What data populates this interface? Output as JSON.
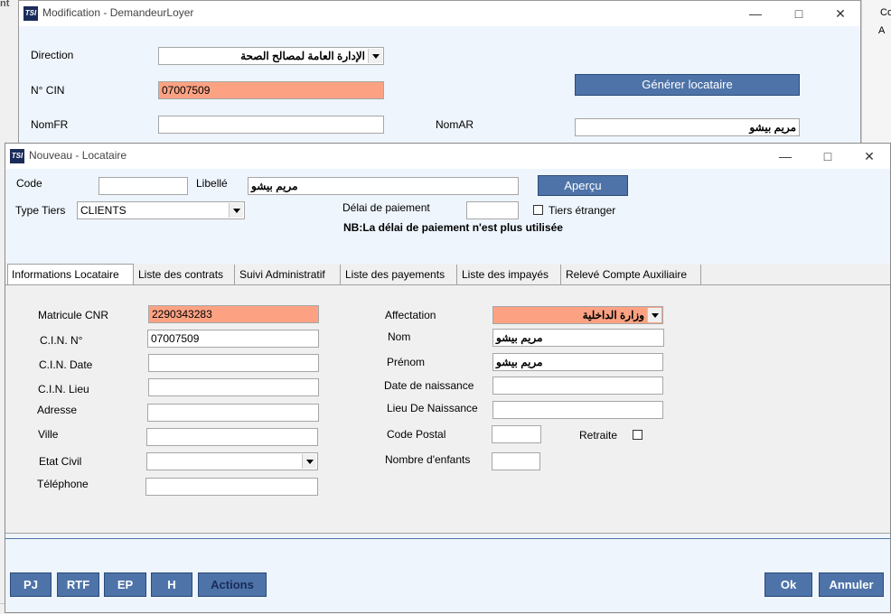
{
  "background_window": {
    "title": "Modification - DemandeurLoyer",
    "direction_label": "Direction",
    "direction_value": "الإدارة العامة لمصالح الصحة",
    "cin_label": "N° CIN",
    "cin_value": "07007509",
    "generate_button": "Générer locataire",
    "nomfr_label": "NomFR",
    "nomfr_value": "",
    "nomar_label": "NomAR",
    "nomar_value": "مريم بيشو"
  },
  "back_edge": {
    "top_left": "nt",
    "top_right": "Co",
    "second_right": "A"
  },
  "dialog": {
    "title": "Nouveau - Locataire",
    "code_label": "Code",
    "code_value": "",
    "libelle_label": "Libellé",
    "libelle_value": "مريم بيشو",
    "apercu_button": "Aperçu",
    "type_tiers_label": "Type Tiers",
    "type_tiers_value": "CLIENTS",
    "delai_label": "Délai de paiement",
    "delai_value": "",
    "tiers_etranger_label": "Tiers étranger",
    "note": "NB:La délai de paiement n'est plus utilisée"
  },
  "tabs": [
    "Informations Locataire",
    "Liste des contrats",
    "Suivi Administratif",
    "Liste des payements",
    "Liste des impayés",
    "Relevé Compte Auxiliaire"
  ],
  "form": {
    "matricule_label": "Matricule CNR",
    "matricule_value": "2290343283",
    "cin_label": "C.I.N. N°",
    "cin_value": "07007509",
    "cin_date_label": "C.I.N. Date",
    "cin_date_value": "",
    "cin_lieu_label": "C.I.N. Lieu",
    "cin_lieu_value": "",
    "adresse_label": "Adresse",
    "adresse_value": "",
    "ville_label": "Ville",
    "ville_value": "",
    "etat_civil_label": "Etat Civil",
    "etat_civil_value": "",
    "telephone_label": "Téléphone",
    "telephone_value": "",
    "affectation_label": "Affectation",
    "affectation_value": "وزارة الداخلية",
    "nom_label": "Nom",
    "nom_value": "مريم بيشو",
    "prenom_label": "Prénom",
    "prenom_value": "مريم بيشو",
    "date_naissance_label": "Date de naissance",
    "date_naissance_value": "",
    "lieu_naissance_label": "Lieu De Naissance",
    "lieu_naissance_value": "",
    "code_postal_label": "Code Postal",
    "code_postal_value": "",
    "retraite_label": "Retraite",
    "nombre_enfants_label": "Nombre d'enfants",
    "nombre_enfants_value": ""
  },
  "footer": {
    "pj": "PJ",
    "rtf": "RTF",
    "ep": "EP",
    "h": "H",
    "actions": "Actions",
    "ok": "Ok",
    "annuler": "Annuler"
  },
  "colors": {
    "highlight": "#fca283",
    "button": "#4e73a8",
    "panel": "#eef5fc"
  }
}
